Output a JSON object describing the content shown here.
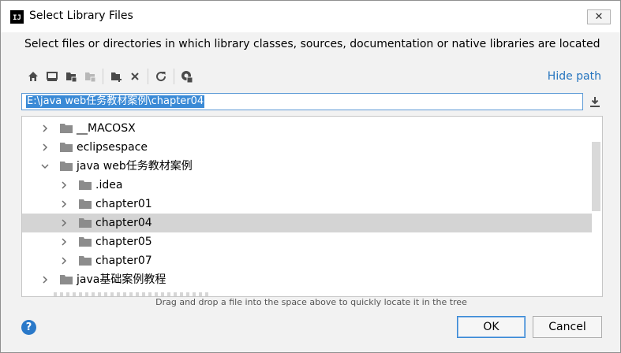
{
  "dialog": {
    "title": "Select Library Files",
    "app_icon_text": "IJ",
    "close_glyph": "✕",
    "description": "Select files or directories in which library classes, sources, documentation or native libraries are located",
    "hide_path": "Hide path",
    "path_value": "E:\\java web任务教材案例\\chapter04",
    "hint": "Drag and drop a file into the space above to quickly locate it in the tree",
    "help_glyph": "?",
    "ok_label": "OK",
    "cancel_label": "Cancel"
  },
  "toolbar": {
    "icons": [
      "home-icon",
      "desktop-icon",
      "project-folder-icon",
      "module-folder-icon",
      "new-folder-icon",
      "delete-icon",
      "refresh-icon",
      "show-hidden-icon"
    ]
  },
  "tree": {
    "items": [
      {
        "label": "__MACOSX",
        "level": 0,
        "expanded": false,
        "selected": false
      },
      {
        "label": "eclipsespace",
        "level": 0,
        "expanded": false,
        "selected": false
      },
      {
        "label": "java web任务教材案例",
        "level": 0,
        "expanded": true,
        "selected": false
      },
      {
        "label": ".idea",
        "level": 1,
        "expanded": false,
        "selected": false
      },
      {
        "label": "chapter01",
        "level": 1,
        "expanded": false,
        "selected": false
      },
      {
        "label": "chapter04",
        "level": 1,
        "expanded": false,
        "selected": true
      },
      {
        "label": "chapter05",
        "level": 1,
        "expanded": false,
        "selected": false
      },
      {
        "label": "chapter07",
        "level": 1,
        "expanded": false,
        "selected": false
      },
      {
        "label": "java基础案例教程",
        "level": 0,
        "expanded": false,
        "selected": false
      }
    ]
  },
  "colors": {
    "accent": "#2675bf",
    "selection_bg": "#3a8ad6",
    "row_selected": "#d4d4d4",
    "folder": "#8c8c8c"
  }
}
